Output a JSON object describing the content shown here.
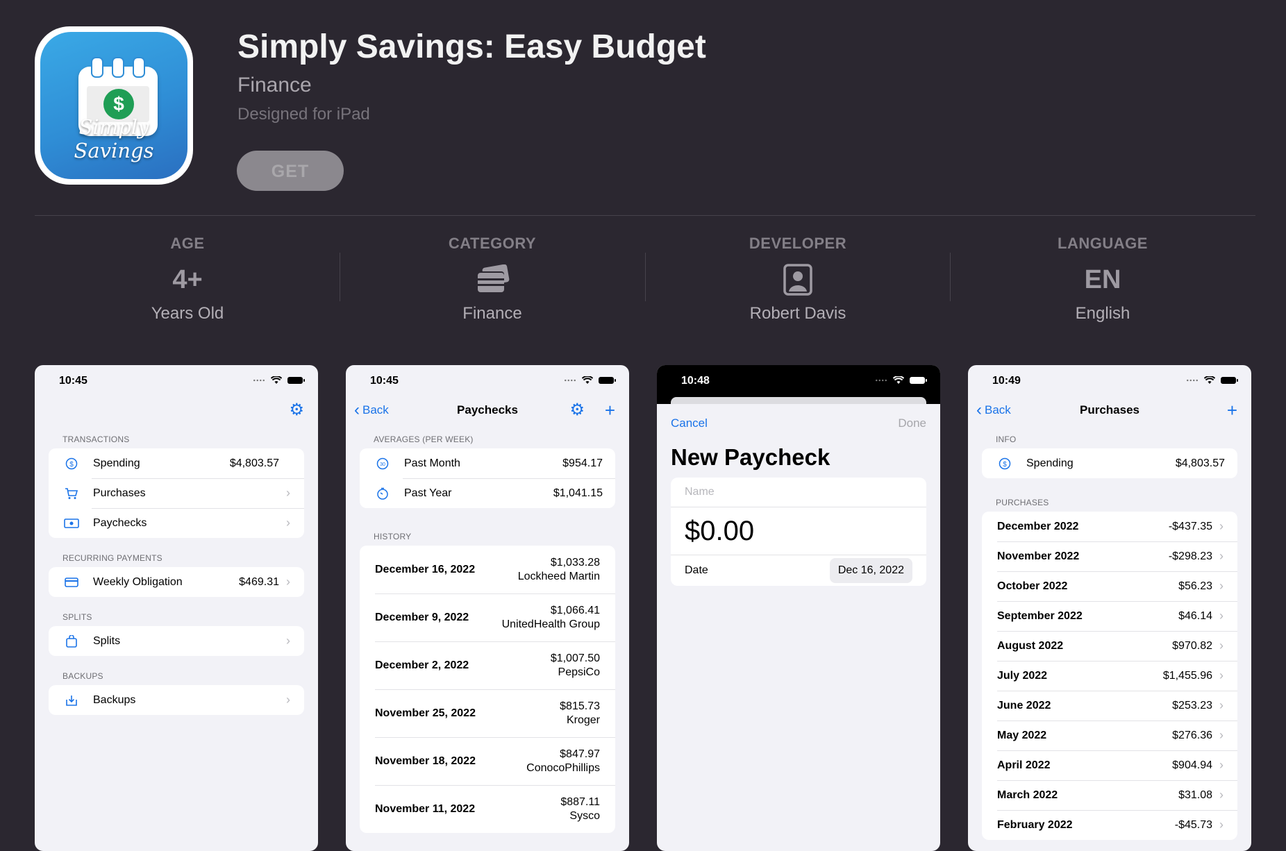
{
  "app": {
    "title": "Simply Savings: Easy Budget",
    "category": "Finance",
    "designed_for": "Designed for iPad",
    "get_label": "GET",
    "icon_text": "Simply Savings",
    "icon_symbol": "$"
  },
  "info": {
    "age": {
      "label": "AGE",
      "value": "4+",
      "sub": "Years Old"
    },
    "category": {
      "label": "CATEGORY",
      "icon": "cards-icon",
      "sub": "Finance"
    },
    "developer": {
      "label": "DEVELOPER",
      "icon": "person-icon",
      "sub": "Robert Davis"
    },
    "language": {
      "label": "LANGUAGE",
      "value": "EN",
      "sub": "English"
    }
  },
  "screens": {
    "s1": {
      "time": "10:45",
      "sections": [
        {
          "header": "TRANSACTIONS",
          "rows": [
            {
              "label": "Spending",
              "value": "$4,803.57"
            },
            {
              "label": "Purchases"
            },
            {
              "label": "Paychecks"
            }
          ]
        },
        {
          "header": "RECURRING PAYMENTS",
          "rows": [
            {
              "label": "Weekly Obligation",
              "value": "$469.31"
            }
          ]
        },
        {
          "header": "SPLITS",
          "rows": [
            {
              "label": "Splits"
            }
          ]
        },
        {
          "header": "BACKUPS",
          "rows": [
            {
              "label": "Backups"
            }
          ]
        }
      ]
    },
    "s2": {
      "time": "10:45",
      "back": "Back",
      "title": "Paychecks",
      "averages_header": "AVERAGES (PER WEEK)",
      "averages": [
        {
          "label": "Past Month",
          "value": "$954.17"
        },
        {
          "label": "Past Year",
          "value": "$1,041.15"
        }
      ],
      "history_header": "HISTORY",
      "history": [
        {
          "date": "December 16, 2022",
          "amount": "$1,033.28",
          "employer": "Lockheed Martin"
        },
        {
          "date": "December 9, 2022",
          "amount": "$1,066.41",
          "employer": "UnitedHealth Group"
        },
        {
          "date": "December 2, 2022",
          "amount": "$1,007.50",
          "employer": "PepsiCo"
        },
        {
          "date": "November 25, 2022",
          "amount": "$815.73",
          "employer": "Kroger"
        },
        {
          "date": "November 18, 2022",
          "amount": "$847.97",
          "employer": "ConocoPhillips"
        },
        {
          "date": "November 11, 2022",
          "amount": "$887.11",
          "employer": "Sysco"
        }
      ]
    },
    "s3": {
      "time": "10:48",
      "cancel": "Cancel",
      "done": "Done",
      "title": "New Paycheck",
      "name_placeholder": "Name",
      "amount": "$0.00",
      "date_label": "Date",
      "date_value": "Dec 16, 2022"
    },
    "s4": {
      "time": "10:49",
      "back": "Back",
      "title": "Purchases",
      "info_header": "INFO",
      "spending_label": "Spending",
      "spending_value": "$4,803.57",
      "purchases_header": "PURCHASES",
      "months": [
        {
          "month": "December 2022",
          "value": "-$437.35"
        },
        {
          "month": "November 2022",
          "value": "-$298.23"
        },
        {
          "month": "October 2022",
          "value": "$56.23"
        },
        {
          "month": "September 2022",
          "value": "$46.14"
        },
        {
          "month": "August 2022",
          "value": "$970.82"
        },
        {
          "month": "July 2022",
          "value": "$1,455.96"
        },
        {
          "month": "June 2022",
          "value": "$253.23"
        },
        {
          "month": "May 2022",
          "value": "$276.36"
        },
        {
          "month": "April 2022",
          "value": "$904.94"
        },
        {
          "month": "March 2022",
          "value": "$31.08"
        },
        {
          "month": "February 2022",
          "value": "-$45.73"
        }
      ]
    }
  },
  "colors": {
    "background": "#2b2730",
    "accent": "#1a73e8",
    "get_button": "#8b888e"
  }
}
